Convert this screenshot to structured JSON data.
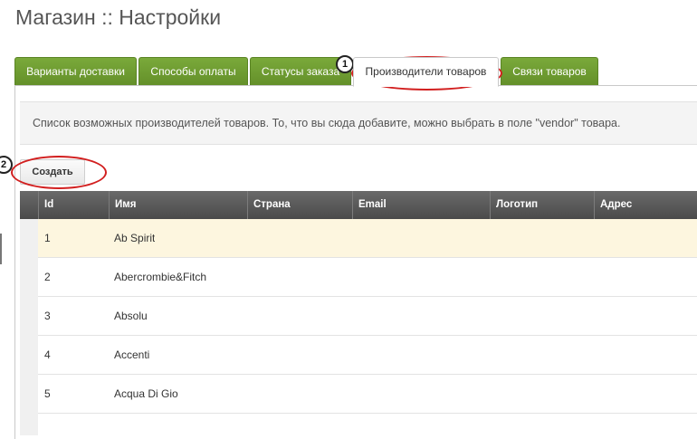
{
  "page": {
    "title": "Магазин :: Настройки"
  },
  "tabs": [
    {
      "label": "Варианты доставки",
      "active": false
    },
    {
      "label": "Способы оплаты",
      "active": false
    },
    {
      "label": "Статусы заказа",
      "active": false
    },
    {
      "label": "Производители товаров",
      "active": true
    },
    {
      "label": "Связи товаров",
      "active": false
    }
  ],
  "info": {
    "text": "Список возможных производителей товаров. То, что вы сюда добавите, можно выбрать в поле \"vendor\" товара."
  },
  "toolbar": {
    "create_label": "Создать"
  },
  "grid": {
    "columns": [
      "Id",
      "Имя",
      "Страна",
      "Email",
      "Логотип",
      "Адрес"
    ],
    "rows": [
      {
        "id": "1",
        "name": "Ab Spirit",
        "selected": true
      },
      {
        "id": "2",
        "name": "Abercrombie&Fitch",
        "selected": false
      },
      {
        "id": "3",
        "name": "Absolu",
        "selected": false
      },
      {
        "id": "4",
        "name": "Accenti",
        "selected": false
      },
      {
        "id": "5",
        "name": "Acqua Di Gio",
        "selected": false
      }
    ]
  },
  "annotations": {
    "marker_1": "1",
    "marker_2": "2",
    "highlight_color": "#d21f1f"
  },
  "colors": {
    "tab_green": "#6d9a2e",
    "header_dark": "#555555",
    "selected_row": "#fdf6df"
  }
}
